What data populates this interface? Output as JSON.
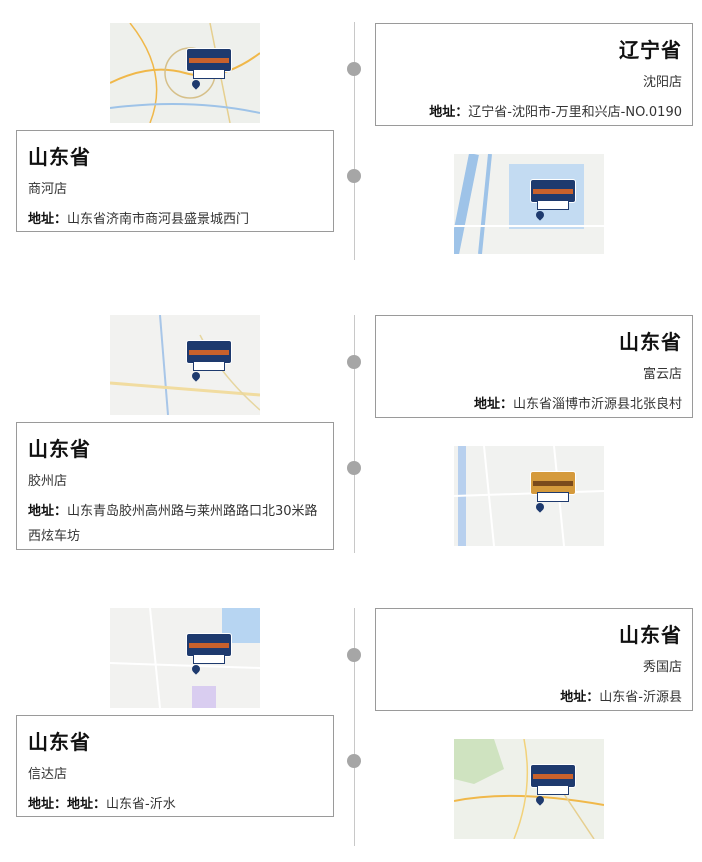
{
  "groups": [
    {
      "left": {
        "province": "山东省",
        "store": "商河店",
        "addr_label": "地址：",
        "address": "山东省济南市商河县盛景城西门"
      },
      "right": {
        "province": "辽宁省",
        "store": "沈阳店",
        "addr_label": "地址：",
        "address": "辽宁省-沈阳市-万里和兴店-NO.0190"
      }
    },
    {
      "left": {
        "province": "山东省",
        "store": "胶州店",
        "addr_label": "地址：",
        "address": "山东青岛胶州高州路与莱州路路口北30米路西炫车坊"
      },
      "right": {
        "province": "山东省",
        "store": "富云店",
        "addr_label": "地址：",
        "address": "山东省淄博市沂源县北张良村"
      }
    },
    {
      "left": {
        "province": "山东省",
        "store": "信达店",
        "addr_label": "地址：地址：",
        "address": "山东省-沂水"
      },
      "right": {
        "province": "山东省",
        "store": "秀国店",
        "addr_label": "地址：",
        "address": "山东省-沂源县"
      }
    }
  ],
  "map_icon": "map-thumbnail",
  "colors": {
    "timeline": "#c8c8c8",
    "dot": "#a6a6a6",
    "card_border": "#9a9a9a",
    "marker": "#1e3a6e"
  }
}
